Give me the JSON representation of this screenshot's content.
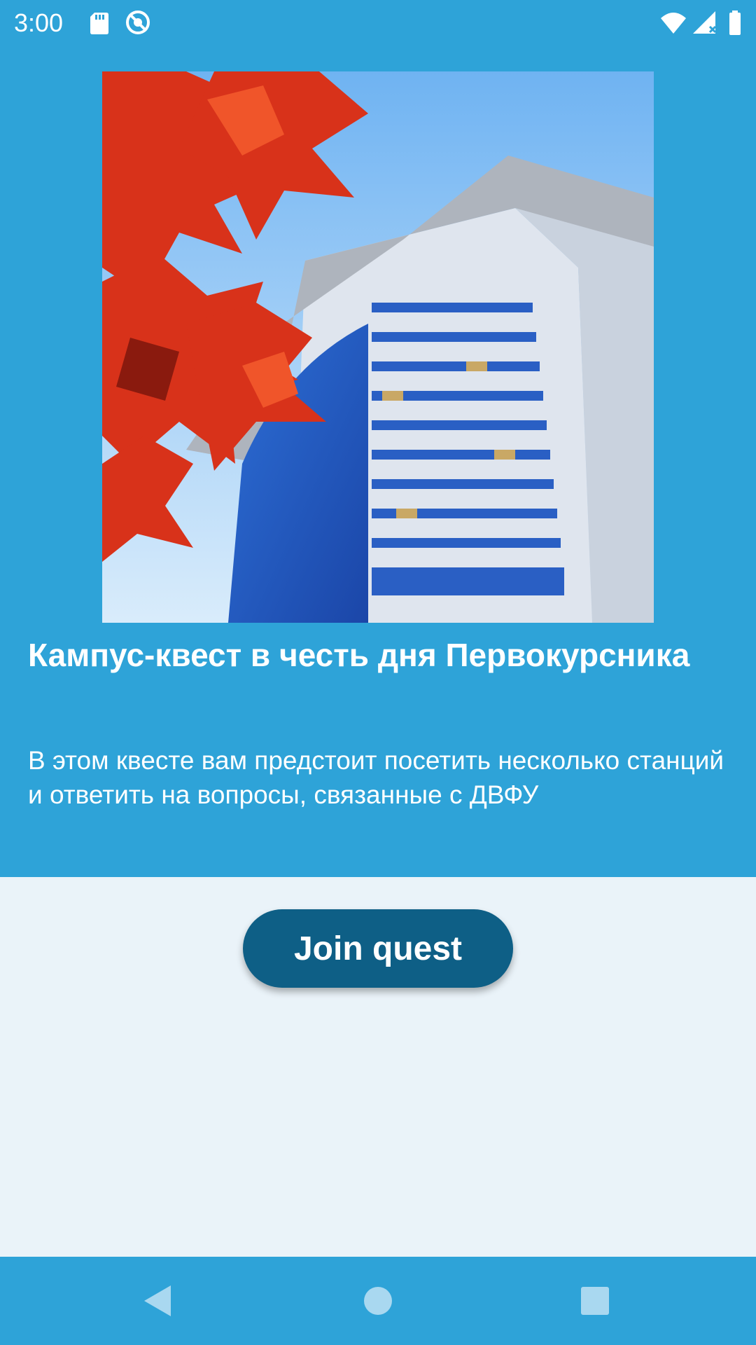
{
  "status_bar": {
    "time": "3:00",
    "icons": [
      "sd-card-icon",
      "sync-disabled-icon",
      "wifi-icon",
      "cellular-signal-icon",
      "battery-icon"
    ]
  },
  "quest": {
    "image": "campus-building-with-red-maple-leaves",
    "title": "Кампус-квест в честь дня Первокурсника",
    "description": "В этом квесте вам предстоит посетить несколько станций и ответить на вопросы, связанные с ДВФУ"
  },
  "actions": {
    "join_label": "Join quest"
  },
  "nav_bar": {
    "icons": [
      "back-icon",
      "home-icon",
      "recents-icon"
    ]
  },
  "colors": {
    "header": "#2ea3d8",
    "background": "#eaf3f9",
    "button": "#0e5f86",
    "text_on_primary": "#ffffff"
  }
}
